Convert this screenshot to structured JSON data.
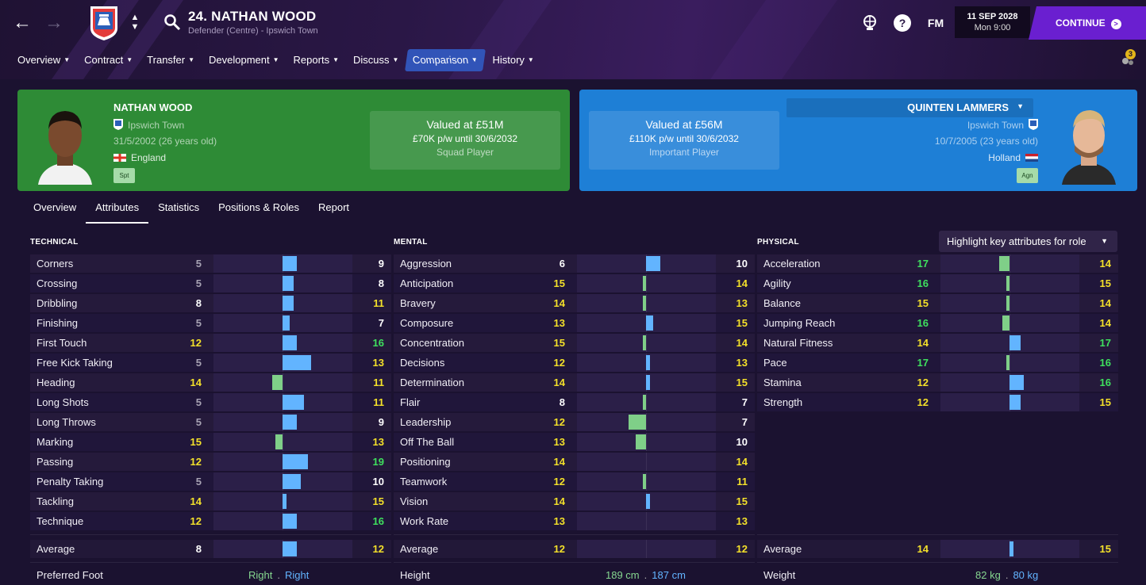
{
  "header": {
    "title": "24. NATHAN WOOD",
    "subtitle": "Defender (Centre) - Ipswich Town",
    "fm_label": "FM",
    "help_label": "?",
    "date": "11 SEP 2028",
    "time": "Mon 9:00",
    "continue_label": "CONTINUE",
    "notifications": "3"
  },
  "nav": {
    "items": [
      {
        "label": "Overview"
      },
      {
        "label": "Contract"
      },
      {
        "label": "Transfer"
      },
      {
        "label": "Development"
      },
      {
        "label": "Reports"
      },
      {
        "label": "Discuss"
      },
      {
        "label": "Comparison",
        "active": true
      },
      {
        "label": "History"
      }
    ]
  },
  "player1": {
    "name": "NATHAN WOOD",
    "club": "Ipswich Town",
    "dob": "31/5/2002 (26 years old)",
    "nation": "England",
    "tag": "Spt",
    "value": "Valued at £51M",
    "contract": "£70K p/w until 30/6/2032",
    "status": "Squad Player"
  },
  "player2": {
    "name": "QUINTEN LAMMERS",
    "club": "Ipswich Town",
    "dob": "10/7/2005 (23 years old)",
    "nation": "Holland",
    "tag": "Agn",
    "value": "Valued at £56M",
    "contract": "£110K p/w until 30/6/2032",
    "status": "Important Player"
  },
  "tabs": [
    "Overview",
    "Attributes",
    "Statistics",
    "Positions & Roles",
    "Report"
  ],
  "highlight_label": "Highlight key attributes for role",
  "colors": {
    "left": "#2e8b36",
    "right": "#1e7fd6",
    "accent": "#6a1fd0",
    "bar_green": "#7fcf88",
    "bar_blue": "#62b4ff"
  },
  "sections": [
    {
      "title": "TECHNICAL",
      "rows": [
        {
          "label": "Corners",
          "a": 5,
          "b": 9
        },
        {
          "label": "Crossing",
          "a": 5,
          "b": 8
        },
        {
          "label": "Dribbling",
          "a": 8,
          "b": 11
        },
        {
          "label": "Finishing",
          "a": 5,
          "b": 7
        },
        {
          "label": "First Touch",
          "a": 12,
          "b": 16
        },
        {
          "label": "Free Kick Taking",
          "a": 5,
          "b": 13
        },
        {
          "label": "Heading",
          "a": 14,
          "b": 11
        },
        {
          "label": "Long Shots",
          "a": 5,
          "b": 11
        },
        {
          "label": "Long Throws",
          "a": 5,
          "b": 9
        },
        {
          "label": "Marking",
          "a": 15,
          "b": 13
        },
        {
          "label": "Passing",
          "a": 12,
          "b": 19
        },
        {
          "label": "Penalty Taking",
          "a": 5,
          "b": 10
        },
        {
          "label": "Tackling",
          "a": 14,
          "b": 15
        },
        {
          "label": "Technique",
          "a": 12,
          "b": 16
        }
      ],
      "average": {
        "label": "Average",
        "a": 8,
        "b": 12
      },
      "footer": {
        "label": "Preferred Foot",
        "a": "Right",
        "b": "Right"
      }
    },
    {
      "title": "MENTAL",
      "rows": [
        {
          "label": "Aggression",
          "a": 6,
          "b": 10
        },
        {
          "label": "Anticipation",
          "a": 15,
          "b": 14
        },
        {
          "label": "Bravery",
          "a": 14,
          "b": 13
        },
        {
          "label": "Composure",
          "a": 13,
          "b": 15
        },
        {
          "label": "Concentration",
          "a": 15,
          "b": 14
        },
        {
          "label": "Decisions",
          "a": 12,
          "b": 13
        },
        {
          "label": "Determination",
          "a": 14,
          "b": 15
        },
        {
          "label": "Flair",
          "a": 8,
          "b": 7
        },
        {
          "label": "Leadership",
          "a": 12,
          "b": 7
        },
        {
          "label": "Off The Ball",
          "a": 13,
          "b": 10
        },
        {
          "label": "Positioning",
          "a": 14,
          "b": 14
        },
        {
          "label": "Teamwork",
          "a": 12,
          "b": 11
        },
        {
          "label": "Vision",
          "a": 14,
          "b": 15
        },
        {
          "label": "Work Rate",
          "a": 13,
          "b": 13
        }
      ],
      "average": {
        "label": "Average",
        "a": 12,
        "b": 12
      },
      "footer": {
        "label": "Height",
        "a": "189 cm",
        "b": "187 cm"
      }
    },
    {
      "title": "PHYSICAL",
      "rows": [
        {
          "label": "Acceleration",
          "a": 17,
          "b": 14
        },
        {
          "label": "Agility",
          "a": 16,
          "b": 15
        },
        {
          "label": "Balance",
          "a": 15,
          "b": 14
        },
        {
          "label": "Jumping Reach",
          "a": 16,
          "b": 14
        },
        {
          "label": "Natural Fitness",
          "a": 14,
          "b": 17
        },
        {
          "label": "Pace",
          "a": 17,
          "b": 16
        },
        {
          "label": "Stamina",
          "a": 12,
          "b": 16
        },
        {
          "label": "Strength",
          "a": 12,
          "b": 15
        }
      ],
      "average": {
        "label": "Average",
        "a": 14,
        "b": 15
      },
      "footer": {
        "label": "Weight",
        "a": "82 kg",
        "b": "80 kg"
      }
    }
  ]
}
